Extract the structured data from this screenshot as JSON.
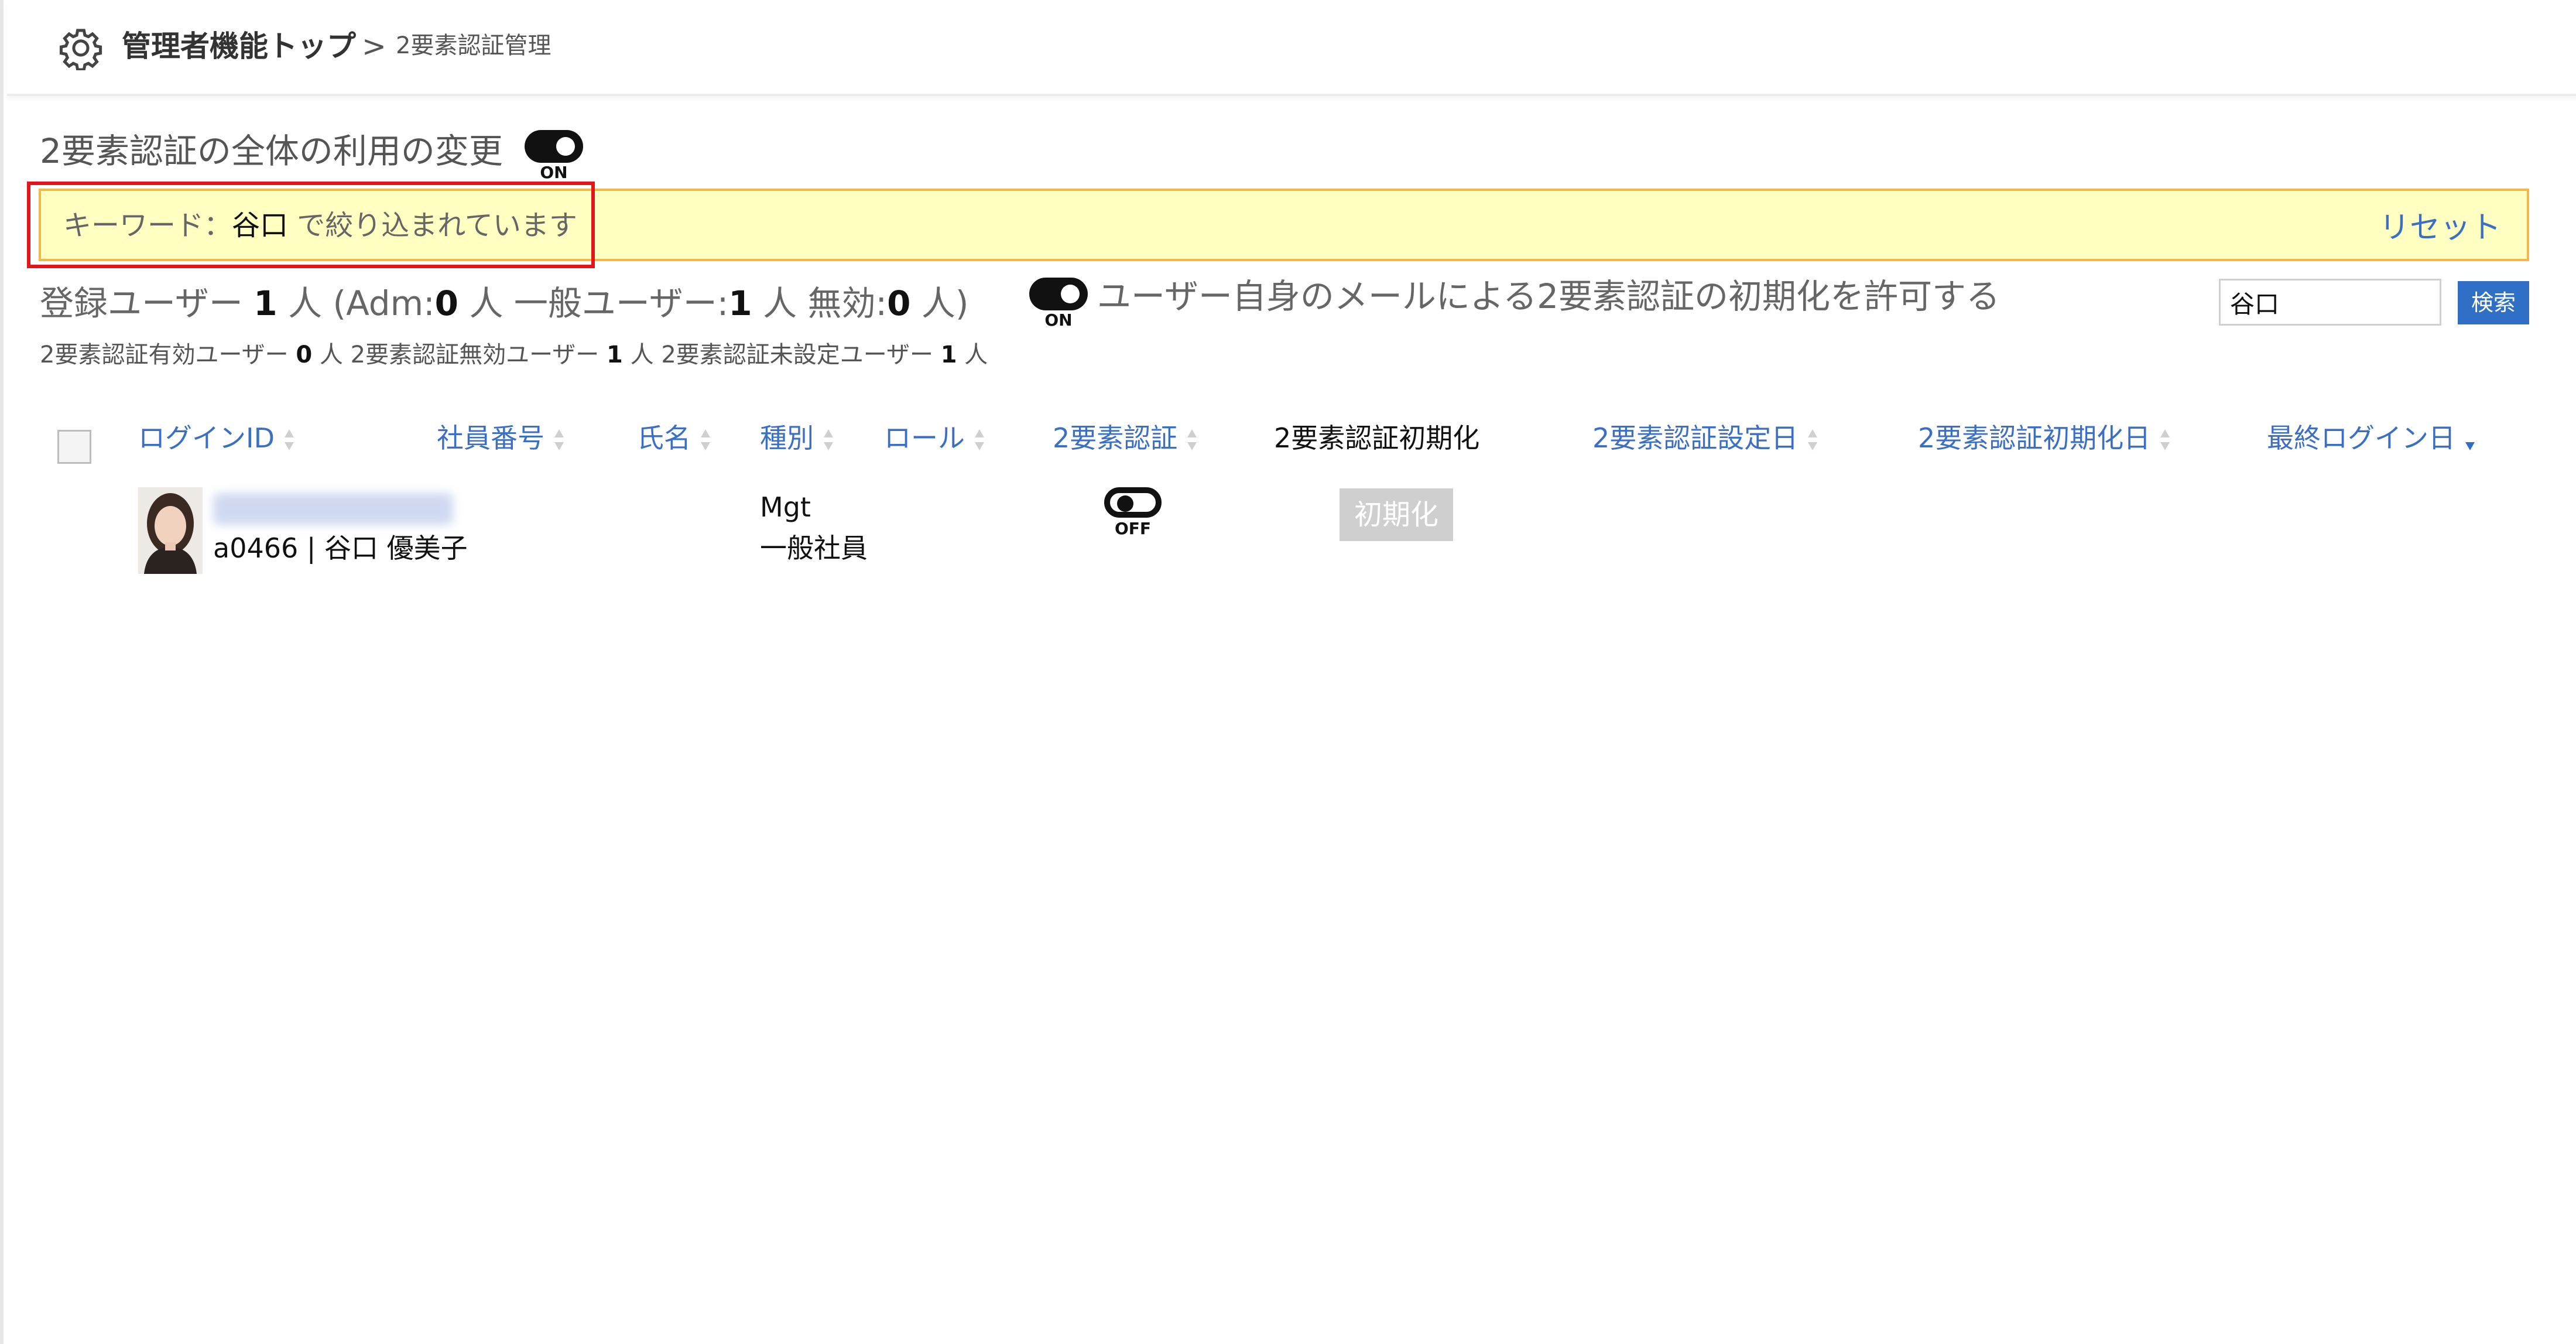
{
  "breadcrumb": {
    "top": "管理者機能トップ",
    "separator": ">",
    "current": "2要素認証管理"
  },
  "global": {
    "label": "2要素認証の全体の利用の変更",
    "toggle_state": "ON"
  },
  "filter": {
    "prefix": "キーワード：",
    "keyword": "谷口",
    "suffix": " で絞り込まれています",
    "reset_label": "リセット"
  },
  "stats": {
    "prefix": "登録ユーザー ",
    "total": "1",
    "open": " 人 (Adm:",
    "adm": "0",
    "mid": " 人 一般ユーザー:",
    "general": "1",
    "end": " 人 無効:",
    "disabled": "0",
    "close": " 人)"
  },
  "self_reset": {
    "toggle_state": "ON",
    "label": "ユーザー自身のメールによる2要素認証の初期化を許可する"
  },
  "search": {
    "value": "谷口",
    "button_label": "検索"
  },
  "sub_stats": {
    "enabled_label": "2要素認証有効ユーザー ",
    "enabled_count": "0",
    "unit1": " 人 ",
    "disabled_label": "2要素認証無効ユーザー ",
    "disabled_count": "1",
    "unit2": " 人 ",
    "unset_label": "2要素認証未設定ユーザー ",
    "unset_count": "1",
    "unit3": " 人"
  },
  "columns": {
    "login_id": "ログインID",
    "employee_no": "社員番号",
    "name": "氏名",
    "category": "種別",
    "role": "ロール",
    "two_factor": "2要素認証",
    "two_factor_init": "2要素認証初期化",
    "setup_date": "2要素認証設定日",
    "init_date": "2要素認証初期化日",
    "last_login": "最終ログイン日"
  },
  "rows": [
    {
      "user_line": "a0466 | 谷口 優美子",
      "category": "Mgt",
      "role": "一般社員",
      "two_factor_state": "OFF",
      "init_button": "初期化"
    }
  ],
  "colors": {
    "link": "#3a6fc4",
    "button": "#2f6fc6",
    "notice_bg": "#ffffc2",
    "notice_border": "#f2b84a",
    "highlight": "#e4141b"
  }
}
